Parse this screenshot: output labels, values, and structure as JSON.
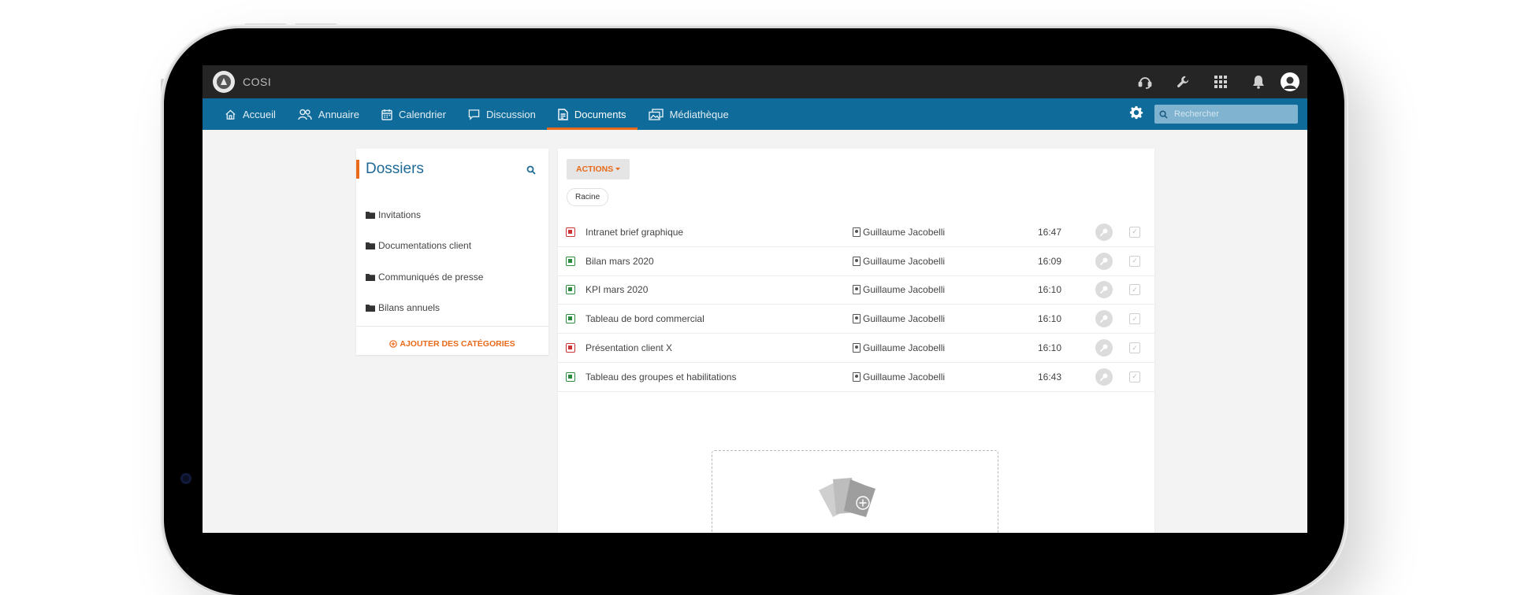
{
  "app": {
    "brand": "COSI"
  },
  "topbar": {
    "icons": [
      "support-headset-icon",
      "wrench-icon",
      "apps-grid-icon",
      "bell-icon",
      "user-avatar"
    ]
  },
  "nav": {
    "items": [
      {
        "label": "Accueil",
        "icon": "home-icon"
      },
      {
        "label": "Annuaire",
        "icon": "users-icon"
      },
      {
        "label": "Calendrier",
        "icon": "calendar-icon"
      },
      {
        "label": "Discussion",
        "icon": "chat-icon"
      },
      {
        "label": "Documents",
        "icon": "document-icon",
        "active": true
      },
      {
        "label": "Médiathèque",
        "icon": "media-icon"
      }
    ],
    "search_placeholder": "Rechercher"
  },
  "sidebar": {
    "title": "Dossiers",
    "folders": [
      "Invitations",
      "Documentations client",
      "Communiqués de presse",
      "Bilans annuels"
    ],
    "add_label": "AJOUTER DES CATÉGORIES"
  },
  "main": {
    "actions_label": "ACTIONS",
    "breadcrumb": "Racine",
    "files": [
      {
        "name": "Intranet brief graphique",
        "type": "pdf",
        "owner": "Guillaume Jacobelli",
        "time": "16:47"
      },
      {
        "name": "Bilan mars 2020",
        "type": "xls",
        "owner": "Guillaume Jacobelli",
        "time": "16:09"
      },
      {
        "name": "KPI mars 2020",
        "type": "xls",
        "owner": "Guillaume Jacobelli",
        "time": "16:10"
      },
      {
        "name": "Tableau de bord commercial",
        "type": "xls",
        "owner": "Guillaume Jacobelli",
        "time": "16:10"
      },
      {
        "name": "Présentation client X",
        "type": "pdf",
        "owner": "Guillaume Jacobelli",
        "time": "16:10"
      },
      {
        "name": "Tableau des groupes et habilitations",
        "type": "xls",
        "owner": "Guillaume Jacobelli",
        "time": "16:43"
      }
    ]
  },
  "colors": {
    "accent": "#e96a1a",
    "nav": "#0f6b99",
    "topbar": "#252525"
  }
}
